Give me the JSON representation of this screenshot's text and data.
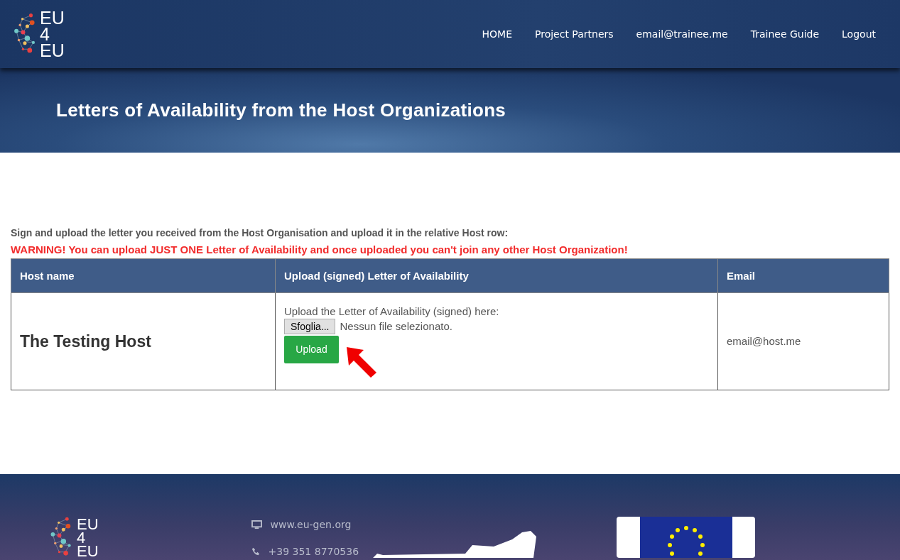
{
  "header": {
    "logo": [
      "EU",
      "4",
      "EU"
    ],
    "nav": [
      {
        "label": "HOME"
      },
      {
        "label": "Project Partners"
      },
      {
        "label": "email@trainee.me"
      },
      {
        "label": "Trainee Guide"
      },
      {
        "label": "Logout"
      }
    ]
  },
  "banner": {
    "title": "Letters of Availability from the Host Organizations"
  },
  "intro": "Sign and upload the letter you received from the Host Organisation and upload it in the relative Host row:",
  "warning": "WARNING! You can upload JUST ONE Letter of Availability and once uploaded you can't join any other Host Organization!",
  "table": {
    "columns": [
      "Host name",
      "Upload (signed) Letter of Availability",
      "Email"
    ],
    "rows": [
      {
        "host": "The Testing Host",
        "upload_label": "Upload the Letter of Availability (signed) here:",
        "browse_button": "Sfoglia...",
        "file_status": "Nessun file selezionato.",
        "upload_button": "Upload",
        "email": "email@host.me"
      }
    ]
  },
  "footer": {
    "logo": [
      "EU",
      "4",
      "EU"
    ],
    "contacts": [
      {
        "kind": "web",
        "text": "www.eu-gen.org"
      },
      {
        "kind": "phone",
        "text": "+39 351 8770536"
      }
    ]
  }
}
